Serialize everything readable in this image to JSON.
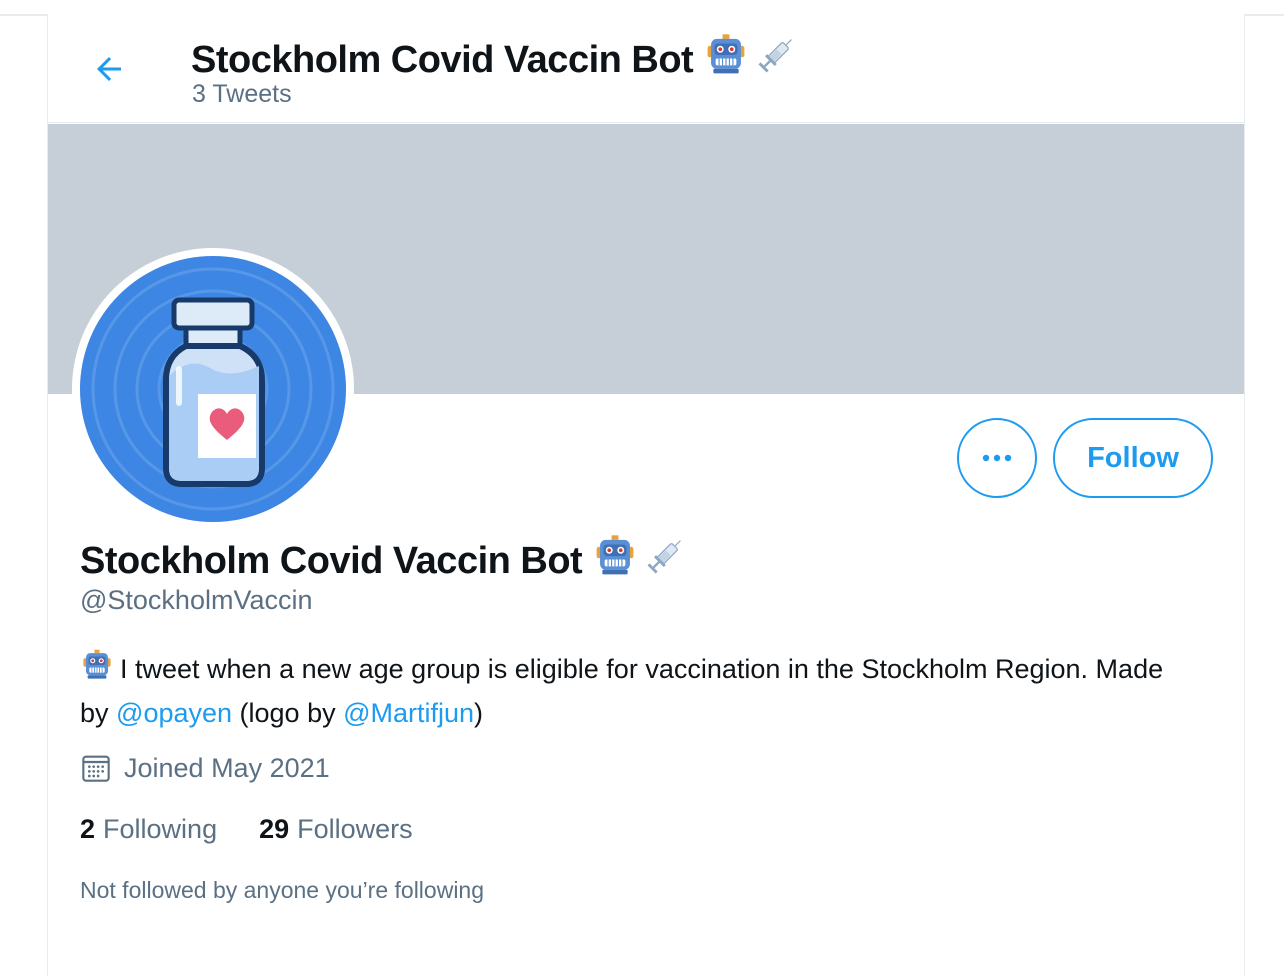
{
  "header": {
    "title": "Stockholm Covid Vaccin Bot",
    "tweet_count": "3 Tweets",
    "back_icon": "arrow-left-icon"
  },
  "profile": {
    "name": "Stockholm Covid Vaccin Bot",
    "handle": "@StockholmVaccin",
    "name_emojis": [
      "robot-icon",
      "syringe-icon"
    ],
    "bio": {
      "part1": "I tweet when a new age group is eligible for vaccination in the Stockholm Region. Made by ",
      "mention1": "@opayen",
      "part2": " (logo by ",
      "mention2": "@Martifjun",
      "part3": ")"
    },
    "joined": "Joined May 2021",
    "following_count": "2",
    "following_label": "Following",
    "followers_count": "29",
    "followers_label": "Followers",
    "not_followed_text": "Not followed by anyone you’re following"
  },
  "actions": {
    "more_icon": "more-horizontal-icon",
    "follow_label": "Follow"
  },
  "colors": {
    "accent": "#1d9bf0",
    "banner": "#c6cfd7",
    "secondary_text": "#5b7083",
    "avatar_bg": "#3d86e3"
  }
}
